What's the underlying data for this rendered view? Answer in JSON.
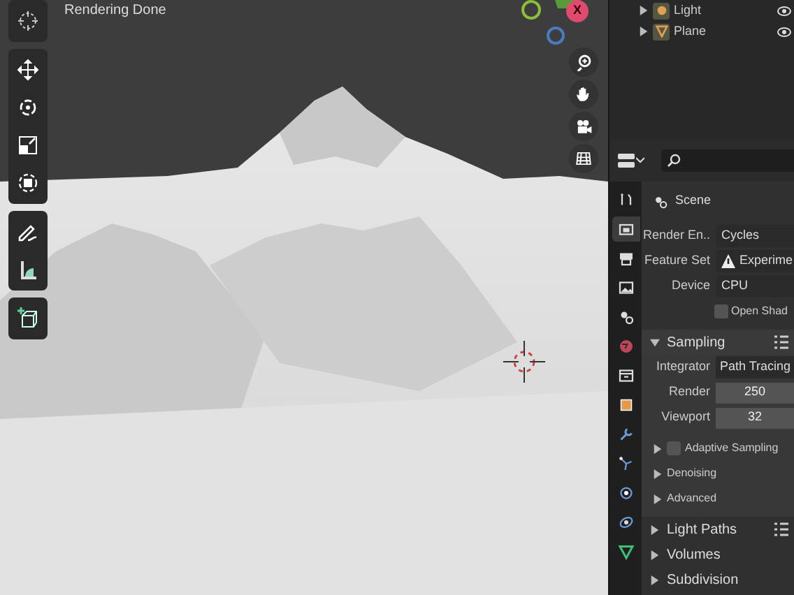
{
  "viewport": {
    "status": "Rendering Done",
    "gizmo_label": "X"
  },
  "outliner": {
    "items": [
      {
        "name": "Light",
        "expanded": false
      },
      {
        "name": "Plane",
        "expanded": false
      }
    ]
  },
  "properties": {
    "tabs": [
      {
        "selected": false
      },
      {
        "selected": true
      },
      {
        "selected": false
      },
      {
        "selected": false
      },
      {
        "selected": false
      },
      {
        "selected": false
      },
      {
        "selected": false
      },
      {
        "selected": false
      },
      {
        "selected": false
      },
      {
        "selected": false
      },
      {
        "selected": false
      },
      {
        "selected": false
      },
      {
        "selected": false
      }
    ],
    "context": "Scene",
    "fields": [
      {
        "label": "Render En..",
        "value": "Cycles",
        "kind": "dropdown"
      },
      {
        "label": "Feature Set",
        "value": "Experime",
        "kind": "warning"
      },
      {
        "label": "Device",
        "value": "CPU",
        "kind": "dropdown"
      }
    ],
    "open_shading": {
      "label": "Open Shad",
      "checked": false
    },
    "panels": [
      {
        "title": "Sampling",
        "expanded": true,
        "presets": true,
        "integrator": {
          "label": "Integrator",
          "value": "Path Tracing"
        },
        "numbers": [
          {
            "label": "Render",
            "value": "250"
          },
          {
            "label": "Viewport",
            "value": "32"
          }
        ],
        "subpanels": [
          {
            "title": "Adaptive Sampling",
            "kind": "checkbox",
            "checked": false,
            "expanded": false
          },
          {
            "title": "Denoising",
            "kind": "plain",
            "expanded": false
          },
          {
            "title": "Advanced",
            "kind": "plain",
            "expanded": false
          }
        ]
      },
      {
        "title": "Light Paths",
        "expanded": false,
        "presets": true
      },
      {
        "title": "Volumes",
        "expanded": false,
        "presets": false
      },
      {
        "title": "Subdivision",
        "expanded": false,
        "presets": false
      }
    ]
  }
}
